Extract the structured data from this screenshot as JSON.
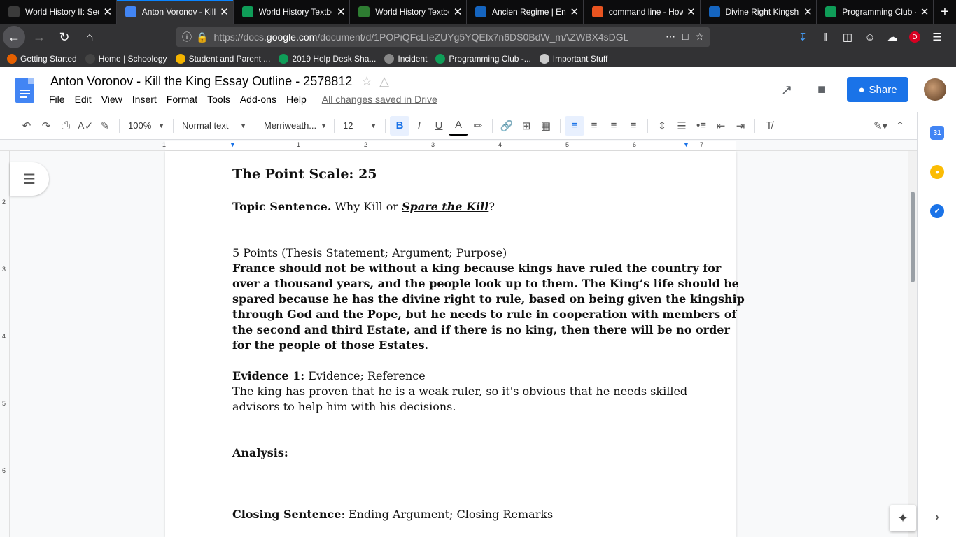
{
  "browser": {
    "tabs": [
      {
        "title": "World History II: Sec",
        "icon": "schoology-icon",
        "color": "#3b3b3b"
      },
      {
        "title": "Anton Voronov - Kill",
        "icon": "google-docs-icon",
        "color": "#4285f4",
        "active": true
      },
      {
        "title": "World History Textbo",
        "icon": "google-drive-icon",
        "color": "#0f9d58"
      },
      {
        "title": "World History Textbo",
        "icon": "green-g-icon",
        "color": "#2e7d32"
      },
      {
        "title": "Ancien Regime | Enc",
        "icon": "britannica-icon",
        "color": "#1565c0"
      },
      {
        "title": "command line - How",
        "icon": "askubuntu-icon",
        "color": "#e95420"
      },
      {
        "title": "Divine Right Kingshi",
        "icon": "britannica-icon",
        "color": "#1565c0"
      },
      {
        "title": "Programming Club -",
        "icon": "google-drive-icon",
        "color": "#0f9d58"
      }
    ],
    "url_prefix": "https://docs.",
    "url_domain": "google.com",
    "url_rest": "/document/d/1POPiQFcLIeZUYg5YQEIx7n6DS0BdW_mAZWBX4sDGL",
    "bookmarks": [
      {
        "label": "Getting Started",
        "color": "#e66000"
      },
      {
        "label": "Home | Schoology",
        "color": "#444"
      },
      {
        "label": "Student and Parent ...",
        "color": "#f4b400"
      },
      {
        "label": "2019 Help Desk Sha...",
        "color": "#0f9d58"
      },
      {
        "label": "Incident",
        "color": "#888"
      },
      {
        "label": "Programming Club -...",
        "color": "#0f9d58"
      },
      {
        "label": "Important Stuff",
        "color": "#ccc"
      }
    ]
  },
  "docs": {
    "title": "Anton Voronov - Kill the King Essay Outline - 2578812",
    "menus": [
      "File",
      "Edit",
      "View",
      "Insert",
      "Format",
      "Tools",
      "Add-ons",
      "Help"
    ],
    "saved_status": "All changes saved in Drive",
    "share_label": "Share",
    "toolbar": {
      "zoom": "100%",
      "style": "Normal text",
      "font": "Merriweath...",
      "size": "12"
    },
    "accent": "#1a73e8"
  },
  "document": {
    "point_scale": "The Point Scale: 25",
    "topic_label": "Topic Sentence.",
    "topic_text_1": " Why Kill or ",
    "topic_text_em": "Spare the Kill",
    "topic_text_2": "?",
    "thesis_header": "5 Points (Thesis Statement; Argument; Purpose)",
    "thesis_lines": [
      "France should not be without a king because kings have ruled the country for",
      "over a thousand years, and the people look up to them. The King’s life should be",
      "spared because  he has the divine right to rule, based on being given the kingship",
      "through God and the Pope, but he needs to rule in cooperation with members of",
      "the second and third Estate, and if there is no king, then there will be no order",
      "for the people of those Estates."
    ],
    "evidence_label": "Evidence 1:",
    "evidence_header": " Evidence; Reference",
    "evidence_lines": [
      "The king has proven that he is a weak ruler, so it's obvious that he needs skilled",
      "advisors to help him with his decisions."
    ],
    "analysis_label": "Analysis:",
    "closing_label": "Closing Sentence",
    "closing_text": ": Ending Argument; Closing Remarks"
  }
}
